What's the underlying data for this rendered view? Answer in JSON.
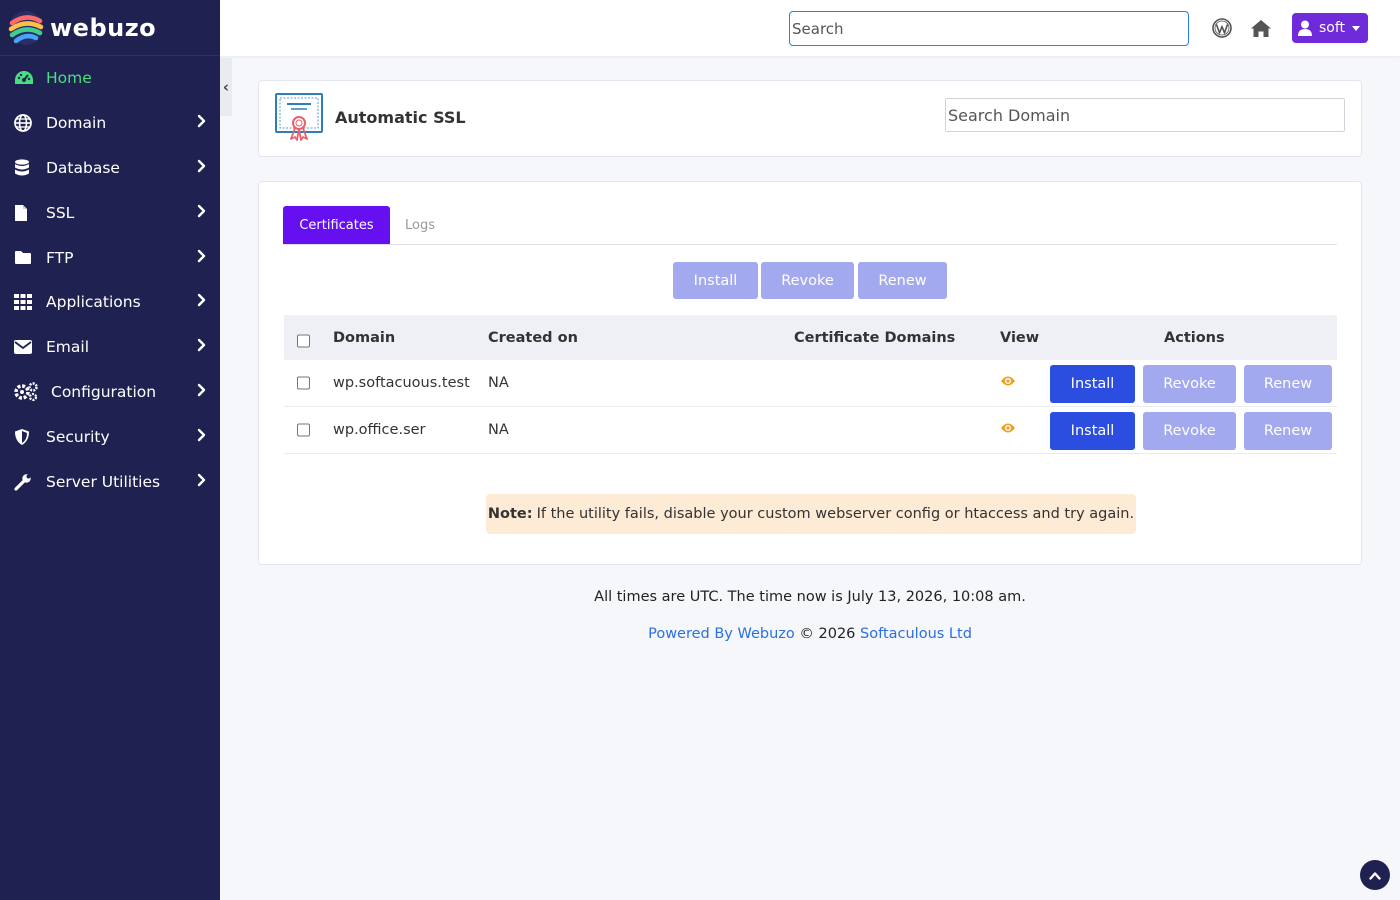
{
  "brand": {
    "name": "webuzo"
  },
  "sidebar": {
    "collapse_label": "‹",
    "items": [
      {
        "label": "Home",
        "icon": "dashboard-icon",
        "active": true
      },
      {
        "label": "Domain",
        "icon": "globe-icon"
      },
      {
        "label": "Database",
        "icon": "database-icon"
      },
      {
        "label": "SSL",
        "icon": "file-icon"
      },
      {
        "label": "FTP",
        "icon": "folder-icon"
      },
      {
        "label": "Applications",
        "icon": "grid-icon"
      },
      {
        "label": "Email",
        "icon": "envelope-icon"
      },
      {
        "label": "Configuration",
        "icon": "cogs-icon"
      },
      {
        "label": "Security",
        "icon": "shield-icon"
      },
      {
        "label": "Server Utilities",
        "icon": "wrench-icon"
      }
    ]
  },
  "topbar": {
    "search_placeholder": "Search",
    "user_label": "soft",
    "accent": "#6f2bd9"
  },
  "header": {
    "title": "Automatic SSL",
    "search_placeholder": "Search Domain"
  },
  "tabs": [
    {
      "label": "Certificates",
      "active": true
    },
    {
      "label": "Logs",
      "active": false
    }
  ],
  "bulk_actions": {
    "install": "Install",
    "revoke": "Revoke",
    "renew": "Renew"
  },
  "table": {
    "columns": {
      "domain": "Domain",
      "created": "Created on",
      "cert_domains": "Certificate Domains",
      "view": "View",
      "actions": "Actions"
    },
    "rows": [
      {
        "domain": "wp.softacuous.test",
        "created": "NA",
        "cert_domains": ""
      },
      {
        "domain": "wp.office.ser",
        "created": "NA",
        "cert_domains": ""
      }
    ],
    "row_actions": {
      "install": "Install",
      "revoke": "Revoke",
      "renew": "Renew"
    }
  },
  "note": {
    "label": "Note:",
    "text": "If the utility fails, disable your custom webserver config or htaccess and try again."
  },
  "footer": {
    "time_text": "All times are UTC. The time now is July 13, 2026, 10:08 am.",
    "powered_by": "Powered By Webuzo",
    "copyright": "© 2026",
    "company": "Softaculous Ltd"
  },
  "colors": {
    "sidebar_bg": "#1f2251",
    "active_nav": "#4ade80",
    "tab_active": "#6610f2",
    "primary_button": "#2b4de0",
    "disabled_button": "#a3a9ef",
    "note_bg": "#fdebd5",
    "link": "#2b6fe0",
    "eye_icon": "#f0a020"
  }
}
